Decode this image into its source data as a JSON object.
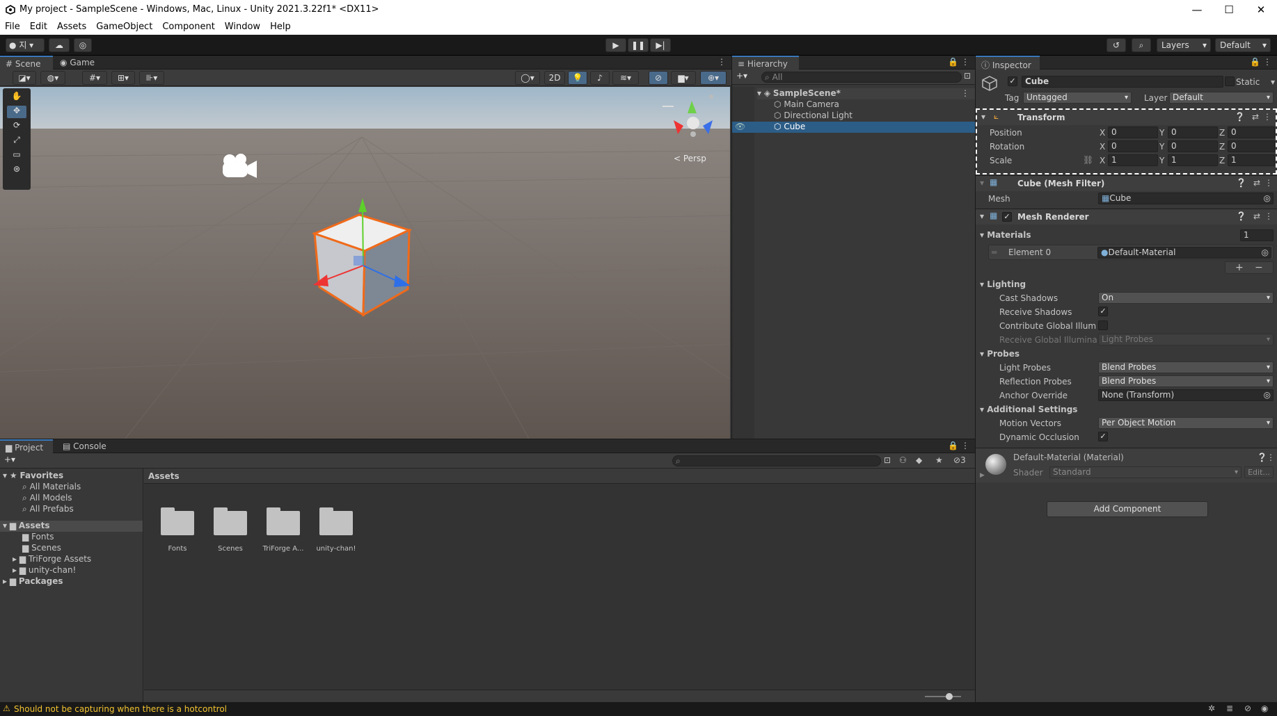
{
  "titlebar": {
    "title": "My project - SampleScene - Windows, Mac, Linux - Unity 2021.3.22f1* <DX11>",
    "minimize": "—",
    "maximize": "☐",
    "close": "✕"
  },
  "menu": [
    "File",
    "Edit",
    "Assets",
    "GameObject",
    "Component",
    "Window",
    "Help"
  ],
  "toolbar": {
    "account": "지",
    "layers_label": "Layers",
    "layout_label": "Default"
  },
  "scene": {
    "tab_scene": "Scene",
    "tab_game": "Game",
    "mode_2d": "2D",
    "persp_label": "< Persp"
  },
  "hierarchy": {
    "tab": "Hierarchy",
    "search_placeholder": "All",
    "scene_name": "SampleScene*",
    "items": [
      "Main Camera",
      "Directional Light",
      "Cube"
    ]
  },
  "inspector": {
    "tab": "Inspector",
    "object_name": "Cube",
    "static_label": "Static",
    "tag_label": "Tag",
    "tag_value": "Untagged",
    "layer_label": "Layer",
    "layer_value": "Default",
    "transform": {
      "title": "Transform",
      "position_label": "Position",
      "rotation_label": "Rotation",
      "scale_label": "Scale",
      "axis_x": "X",
      "axis_y": "Y",
      "axis_z": "Z",
      "position": [
        "0",
        "0",
        "0"
      ],
      "rotation": [
        "0",
        "0",
        "0"
      ],
      "scale": [
        "1",
        "1",
        "1"
      ]
    },
    "mesh_filter": {
      "title": "Cube (Mesh Filter)",
      "mesh_label": "Mesh",
      "mesh_value": "Cube"
    },
    "mesh_renderer": {
      "title": "Mesh Renderer",
      "materials_label": "Materials",
      "materials_count": "1",
      "element0_label": "Element 0",
      "element0_value": "Default-Material",
      "lighting_label": "Lighting",
      "cast_shadows_label": "Cast Shadows",
      "cast_shadows_value": "On",
      "receive_shadows_label": "Receive Shadows",
      "contribute_gi_label": "Contribute Global Illumina",
      "receive_gi_label": "Receive Global Illuminati",
      "receive_gi_value": "Light Probes",
      "probes_label": "Probes",
      "light_probes_label": "Light Probes",
      "light_probes_value": "Blend Probes",
      "reflection_probes_label": "Reflection Probes",
      "reflection_probes_value": "Blend Probes",
      "anchor_override_label": "Anchor Override",
      "anchor_override_value": "None (Transform)",
      "additional_label": "Additional Settings",
      "motion_vectors_label": "Motion Vectors",
      "motion_vectors_value": "Per Object Motion",
      "dynamic_occlusion_label": "Dynamic Occlusion"
    },
    "material": {
      "title": "Default-Material (Material)",
      "shader_label": "Shader",
      "shader_value": "Standard",
      "edit_label": "Edit..."
    },
    "add_component": "Add Component"
  },
  "project": {
    "tab_project": "Project",
    "tab_console": "Console",
    "hidden_count": "3",
    "favorites_label": "Favorites",
    "favorites": [
      "All Materials",
      "All Models",
      "All Prefabs"
    ],
    "assets_label": "Assets",
    "asset_folders": [
      "Fonts",
      "Scenes",
      "TriForge Assets",
      "unity-chan!"
    ],
    "packages_label": "Packages",
    "breadcrumb": "Assets",
    "grid_items": [
      "Fonts",
      "Scenes",
      "TriForge A...",
      "unity-chan!"
    ]
  },
  "status": {
    "message": "Should not be capturing when there is a hotcontrol"
  },
  "colors": {
    "selection": "#2c5d87",
    "accent": "#3a79bb",
    "warning": "#f4c430"
  }
}
